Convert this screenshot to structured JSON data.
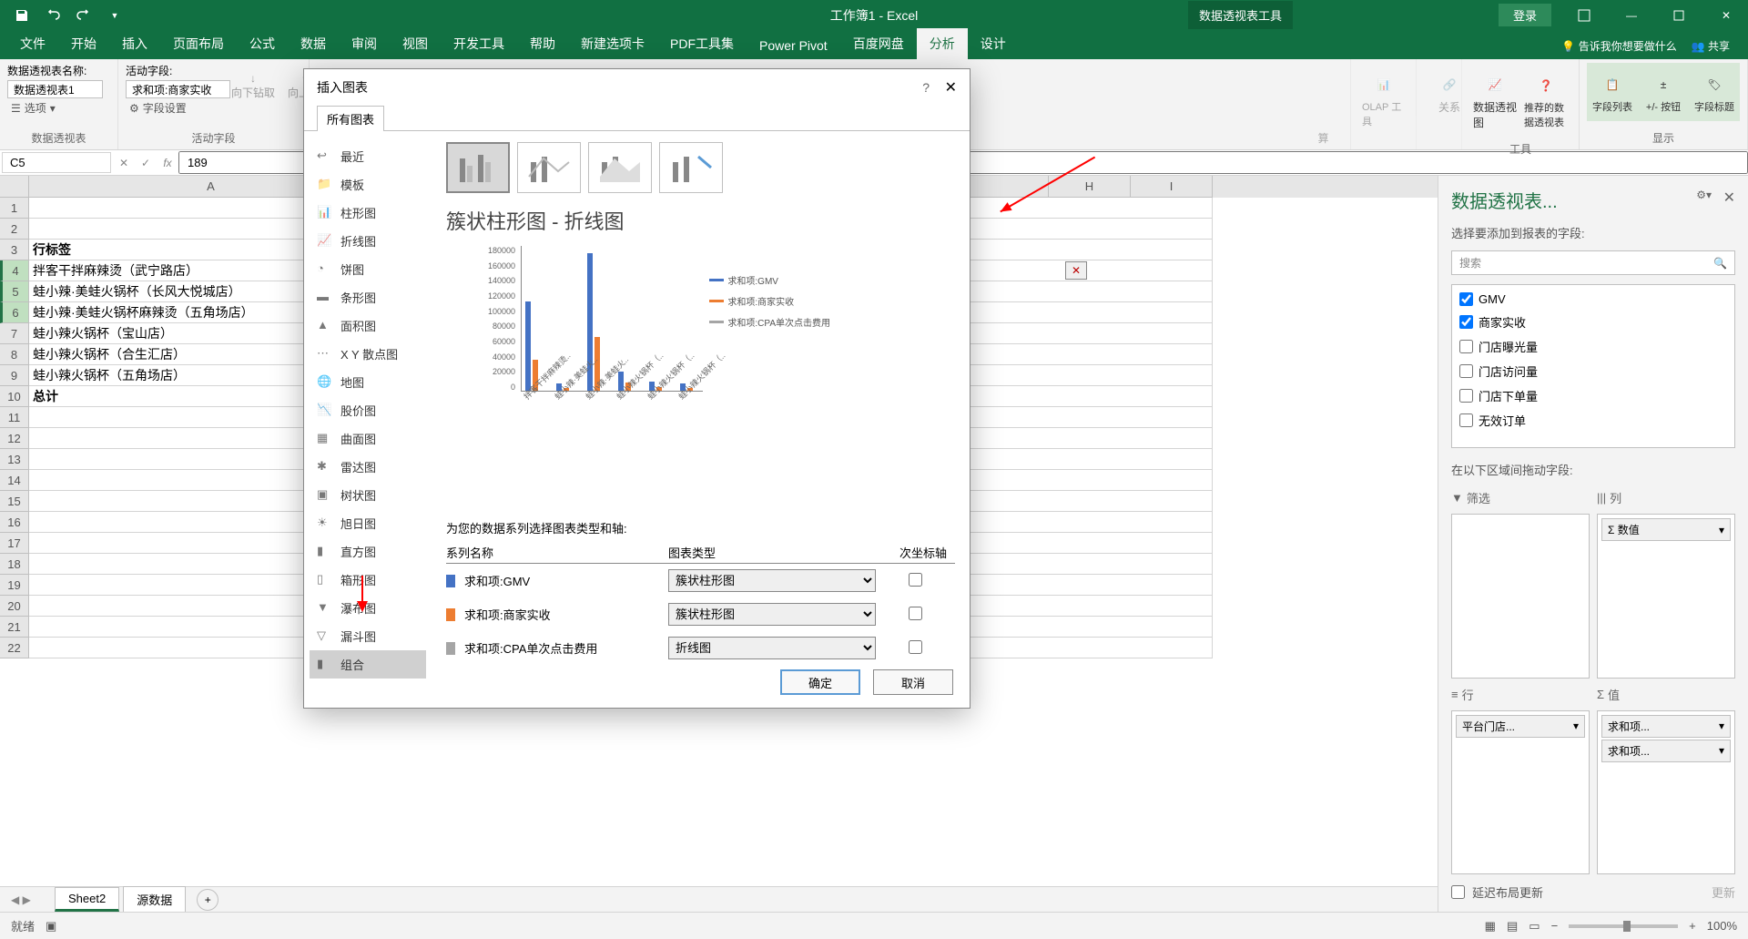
{
  "title": "工作簿1 - Excel",
  "tool_tab": "数据透视表工具",
  "login": "登录",
  "share": "共享",
  "tabs": [
    "文件",
    "开始",
    "插入",
    "页面布局",
    "公式",
    "数据",
    "审阅",
    "视图",
    "开发工具",
    "帮助",
    "新建选项卡",
    "PDF工具集",
    "Power Pivot",
    "百度网盘",
    "分析",
    "设计"
  ],
  "tell_me": "告诉我你想要做什么",
  "ribbon": {
    "pt_name_lbl": "数据透视表名称:",
    "pt_name_val": "数据透视表1",
    "options": "选项",
    "group1": "数据透视表",
    "active_field_lbl": "活动字段:",
    "active_field_val": "求和项:商家实收",
    "field_settings": "字段设置",
    "drill_down": "向下钻取",
    "drill_up": "向上钻",
    "group2": "活动字段",
    "calc": "算",
    "olap": "OLAP 工具",
    "relations": "关系",
    "pivotchart": "数据透视图",
    "rec_pivot": "推荐的数据透视表",
    "tools": "工具",
    "field_list": "字段列表",
    "pm_btn": "+/- 按钮",
    "field_hdr": "字段标题",
    "show": "显示"
  },
  "namebox": "C5",
  "fx_val": "189",
  "cols": [
    "A",
    "H",
    "I"
  ],
  "colA_width": 400,
  "rows": [
    "",
    "",
    "行标签",
    "拌客干拌麻辣烫（武宁路店）",
    "蛙小辣·美蛙火锅杯（长风大悦城店）",
    "蛙小辣·美蛙火锅杯麻辣烫（五角场店）",
    "蛙小辣火锅杯（宝山店）",
    "蛙小辣火锅杯（合生汇店）",
    "蛙小辣火锅杯（五角场店）",
    "总计"
  ],
  "sheets": {
    "active": "Sheet2",
    "other": "源数据"
  },
  "status": "就绪",
  "zoom": "100%",
  "fieldpane": {
    "title": "数据透视表...",
    "subtitle": "选择要添加到报表的字段:",
    "search": "搜索",
    "fields": [
      {
        "name": "GMV",
        "checked": true
      },
      {
        "name": "商家实收",
        "checked": true
      },
      {
        "name": "门店曝光量",
        "checked": false
      },
      {
        "name": "门店访问量",
        "checked": false
      },
      {
        "name": "门店下单量",
        "checked": false
      },
      {
        "name": "无效订单",
        "checked": false
      }
    ],
    "drag_lbl": "在以下区域间拖动字段:",
    "areas": {
      "filter": "筛选",
      "cols": "列",
      "rows": "行",
      "vals": "值"
    },
    "col_items": [
      "Σ 数值"
    ],
    "row_items": [
      "平台门店..."
    ],
    "val_items": [
      "求和项...",
      "求和项..."
    ],
    "defer": "延迟布局更新",
    "update": "更新"
  },
  "dialog": {
    "title": "插入图表",
    "tab": "所有图表",
    "side": [
      "最近",
      "模板",
      "柱形图",
      "折线图",
      "饼图",
      "条形图",
      "面积图",
      "X Y 散点图",
      "地图",
      "股价图",
      "曲面图",
      "雷达图",
      "树状图",
      "旭日图",
      "直方图",
      "箱形图",
      "瀑布图",
      "漏斗图",
      "组合"
    ],
    "chart_name": "簇状柱形图 - 折线图",
    "legend": [
      "求和项:GMV",
      "求和项:商家实收",
      "求和项:CPA单次点击费用"
    ],
    "series_hdr": "为您的数据系列选择图表类型和轴:",
    "cols": [
      "系列名称",
      "图表类型",
      "次坐标轴"
    ],
    "series": [
      {
        "name": "求和项:GMV",
        "type": "簇状柱形图",
        "color": "#4472c4"
      },
      {
        "name": "求和项:商家实收",
        "type": "簇状柱形图",
        "color": "#ed7d31"
      },
      {
        "name": "求和项:CPA单次点击费用",
        "type": "折线图",
        "color": "#a5a5a5"
      }
    ],
    "ok": "确定",
    "cancel": "取消"
  },
  "chart_data": {
    "type": "combo",
    "title": "簇状柱形图 - 折线图",
    "ylim": [
      0,
      180000
    ],
    "yticks": [
      0,
      20000,
      40000,
      60000,
      80000,
      100000,
      120000,
      140000,
      160000,
      180000
    ],
    "categories": [
      "拌客干拌麻辣烫（武宁路店）",
      "蛙小辣·美蛙火锅杯（长风大悦城店）",
      "蛙小辣·美蛙火锅杯麻辣烫（五角场店）",
      "蛙小辣火锅杯（宝山店）",
      "蛙小辣火锅杯（合生汇店）",
      "蛙小辣火锅杯（五角场店）"
    ],
    "series": [
      {
        "name": "求和项:GMV",
        "type": "bar",
        "color": "#4472c4",
        "values": [
          110000,
          9000,
          170000,
          24000,
          11000,
          9000
        ]
      },
      {
        "name": "求和项:商家实收",
        "type": "bar",
        "color": "#ed7d31",
        "values": [
          38000,
          3000,
          66000,
          10000,
          4000,
          3000
        ]
      },
      {
        "name": "求和项:CPA单次点击费用",
        "type": "line",
        "color": "#a5a5a5",
        "values": [
          1200,
          600,
          1800,
          800,
          500,
          400
        ]
      }
    ]
  }
}
